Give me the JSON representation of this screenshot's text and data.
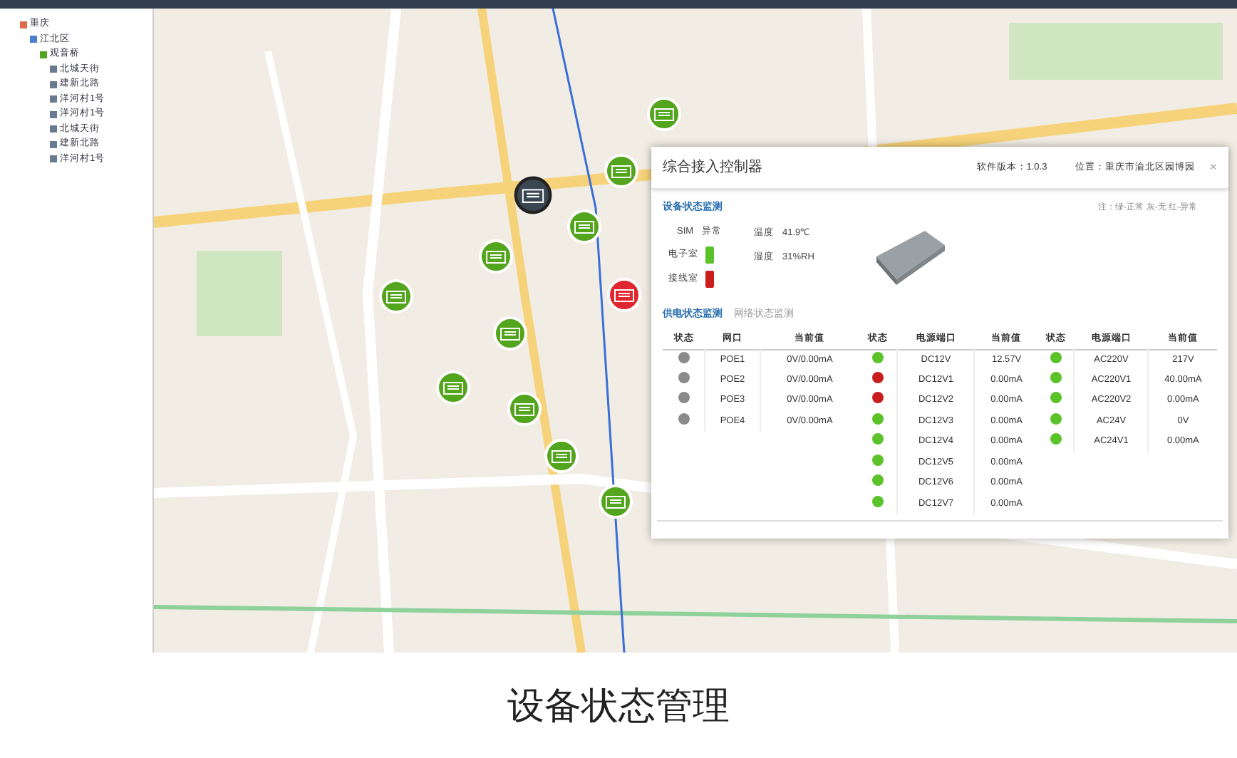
{
  "tree": {
    "label": "重庆",
    "children": [
      {
        "label": "江北区",
        "children": [
          {
            "label": "观音桥",
            "children": [
              {
                "label": "北城天街"
              },
              {
                "label": "建新北路"
              },
              {
                "label": "洋河村1号"
              },
              {
                "label": "洋河村1号"
              },
              {
                "label": "北城天街"
              },
              {
                "label": "建新北路"
              },
              {
                "label": "洋河村1号"
              }
            ]
          }
        ]
      }
    ]
  },
  "map": {
    "markers": [
      {
        "color": "#52a51c",
        "selected": false
      },
      {
        "color": "#52a51c",
        "selected": false
      },
      {
        "color": "#3b4653",
        "selected": true
      },
      {
        "color": "#52a51c",
        "selected": false
      },
      {
        "color": "#52a51c",
        "selected": false
      },
      {
        "color": "#e0262e",
        "selected": false
      },
      {
        "color": "#52a51c",
        "selected": false
      },
      {
        "color": "#52a51c",
        "selected": false
      },
      {
        "color": "#52a51c",
        "selected": false
      },
      {
        "color": "#52a51c",
        "selected": false
      },
      {
        "color": "#52a51c",
        "selected": false
      },
      {
        "color": "#52a51c",
        "selected": false
      }
    ]
  },
  "panel": {
    "title": "综合接入控制器",
    "version": "软件版本：1.0.3",
    "location": "位置：重庆市渝北区园博园",
    "close": "×",
    "section_title": "设备状态监测",
    "legend": "注：绿-正常 灰-无 红-异常",
    "sim": {
      "label": "SIM",
      "value": "异常"
    },
    "rooms": [
      {
        "label": "电子室",
        "color": "#5cc22a"
      },
      {
        "label": "接线室",
        "color": "#c81e1e"
      }
    ],
    "readings": [
      {
        "label": "温度",
        "value": "41.9℃"
      },
      {
        "label": "湿度",
        "value": "31%RH"
      }
    ],
    "tabs": [
      {
        "label": "供电状态监测",
        "selected": true
      },
      {
        "label": "网络状态监测",
        "selected": false
      }
    ],
    "groups": [
      {
        "columns": [
          "状态",
          "网口",
          "当前值"
        ],
        "rows": [
          {
            "color": "#8a8a8a",
            "port": "POE1",
            "value": "0V/0.00mA"
          },
          {
            "color": "#8a8a8a",
            "port": "POE2",
            "value": "0V/0.00mA"
          },
          {
            "color": "#8a8a8a",
            "port": "POE3",
            "value": "0V/0.00mA"
          },
          {
            "color": "#8a8a8a",
            "port": "POE4",
            "value": "0V/0.00mA"
          }
        ]
      },
      {
        "columns": [
          "状态",
          "电源端口",
          "当前值"
        ],
        "rows": [
          {
            "color": "#5cc22a",
            "port": "DC12V",
            "value": "12.57V"
          },
          {
            "color": "#c81e1e",
            "port": "DC12V1",
            "value": "0.00mA"
          },
          {
            "color": "#c81e1e",
            "port": "DC12V2",
            "value": "0.00mA"
          },
          {
            "color": "#5cc22a",
            "port": "DC12V3",
            "value": "0.00mA"
          },
          {
            "color": "#5cc22a",
            "port": "DC12V4",
            "value": "0.00mA"
          },
          {
            "color": "#5cc22a",
            "port": "DC12V5",
            "value": "0.00mA"
          },
          {
            "color": "#5cc22a",
            "port": "DC12V6",
            "value": "0.00mA"
          },
          {
            "color": "#5cc22a",
            "port": "DC12V7",
            "value": "0.00mA"
          }
        ]
      },
      {
        "columns": [
          "状态",
          "电源端口",
          "当前值"
        ],
        "rows": [
          {
            "color": "#5cc22a",
            "port": "AC220V",
            "value": "217V"
          },
          {
            "color": "#5cc22a",
            "port": "AC220V1",
            "value": "40.00mA"
          },
          {
            "color": "#5cc22a",
            "port": "AC220V2",
            "value": "0.00mA"
          },
          {
            "color": "#5cc22a",
            "port": "AC24V",
            "value": "0V"
          },
          {
            "color": "#5cc22a",
            "port": "AC24V1",
            "value": "0.00mA"
          }
        ]
      }
    ]
  },
  "caption": "设备状态管理"
}
